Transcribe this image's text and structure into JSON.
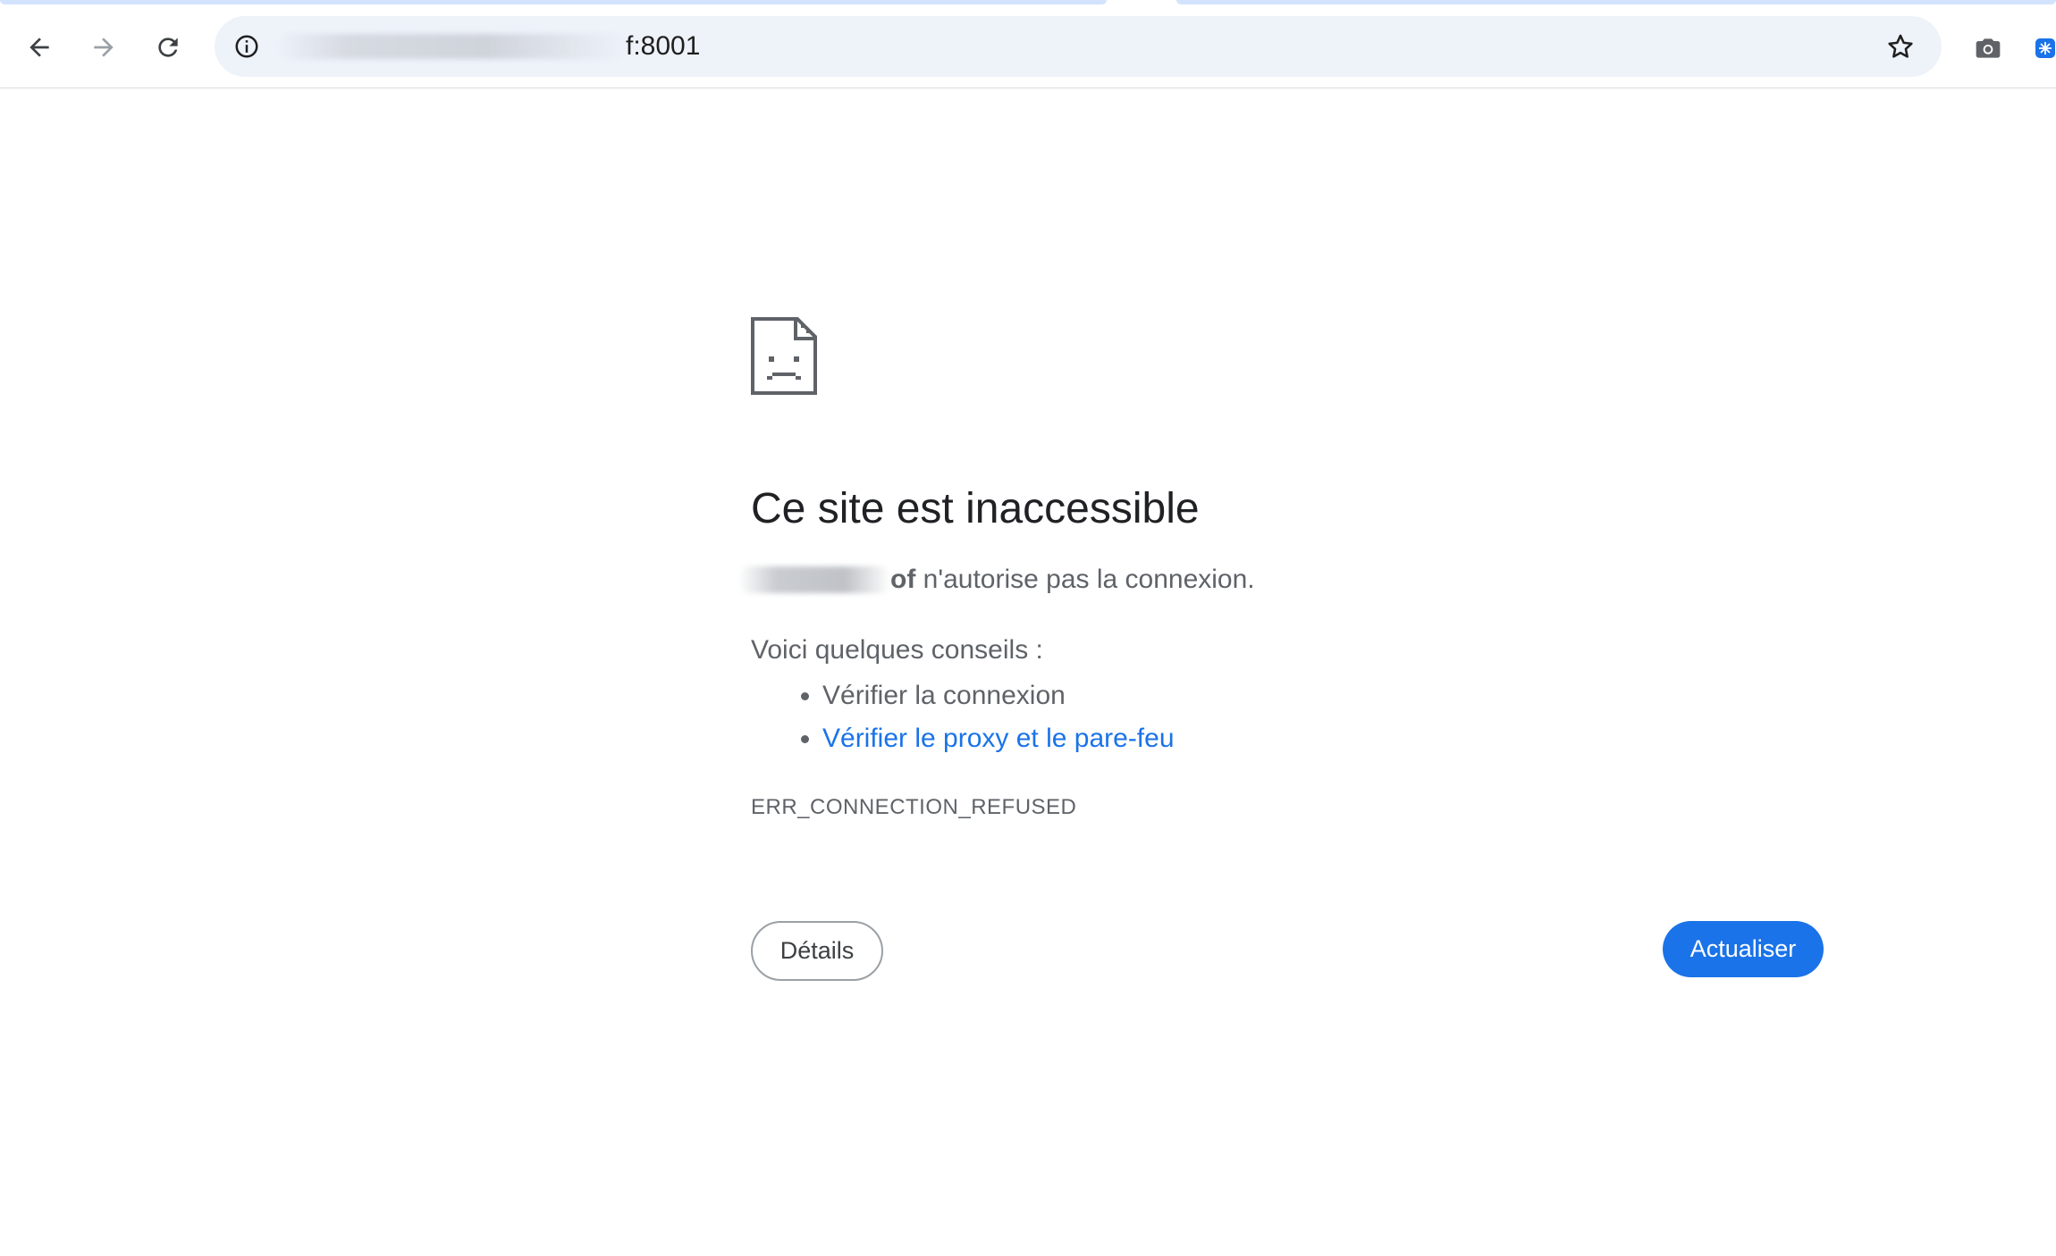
{
  "browser": {
    "url_suffix": "f:8001",
    "icons": {
      "back": "arrow-left-icon",
      "forward": "arrow-right-icon",
      "reload": "reload-icon",
      "site_info": "info-icon",
      "bookmark": "star-icon",
      "screenshot": "camera-icon",
      "extension": "extension-icon"
    }
  },
  "error_page": {
    "icon": "sad-document-icon",
    "title": "Ce site est inaccessible",
    "host_visible_tail": "of",
    "description_suffix": " n'autorise pas la connexion.",
    "tips_title": "Voici quelques conseils :",
    "tips": [
      "Vérifier la connexion",
      "Vérifier le proxy et le pare-feu"
    ],
    "error_code": "ERR_CONNECTION_REFUSED",
    "details_button": "Détails",
    "reload_button": "Actualiser"
  },
  "colors": {
    "primary": "#1a73e8",
    "omnibox_bg": "#eef2f9",
    "secondary_text": "#5f6368"
  }
}
